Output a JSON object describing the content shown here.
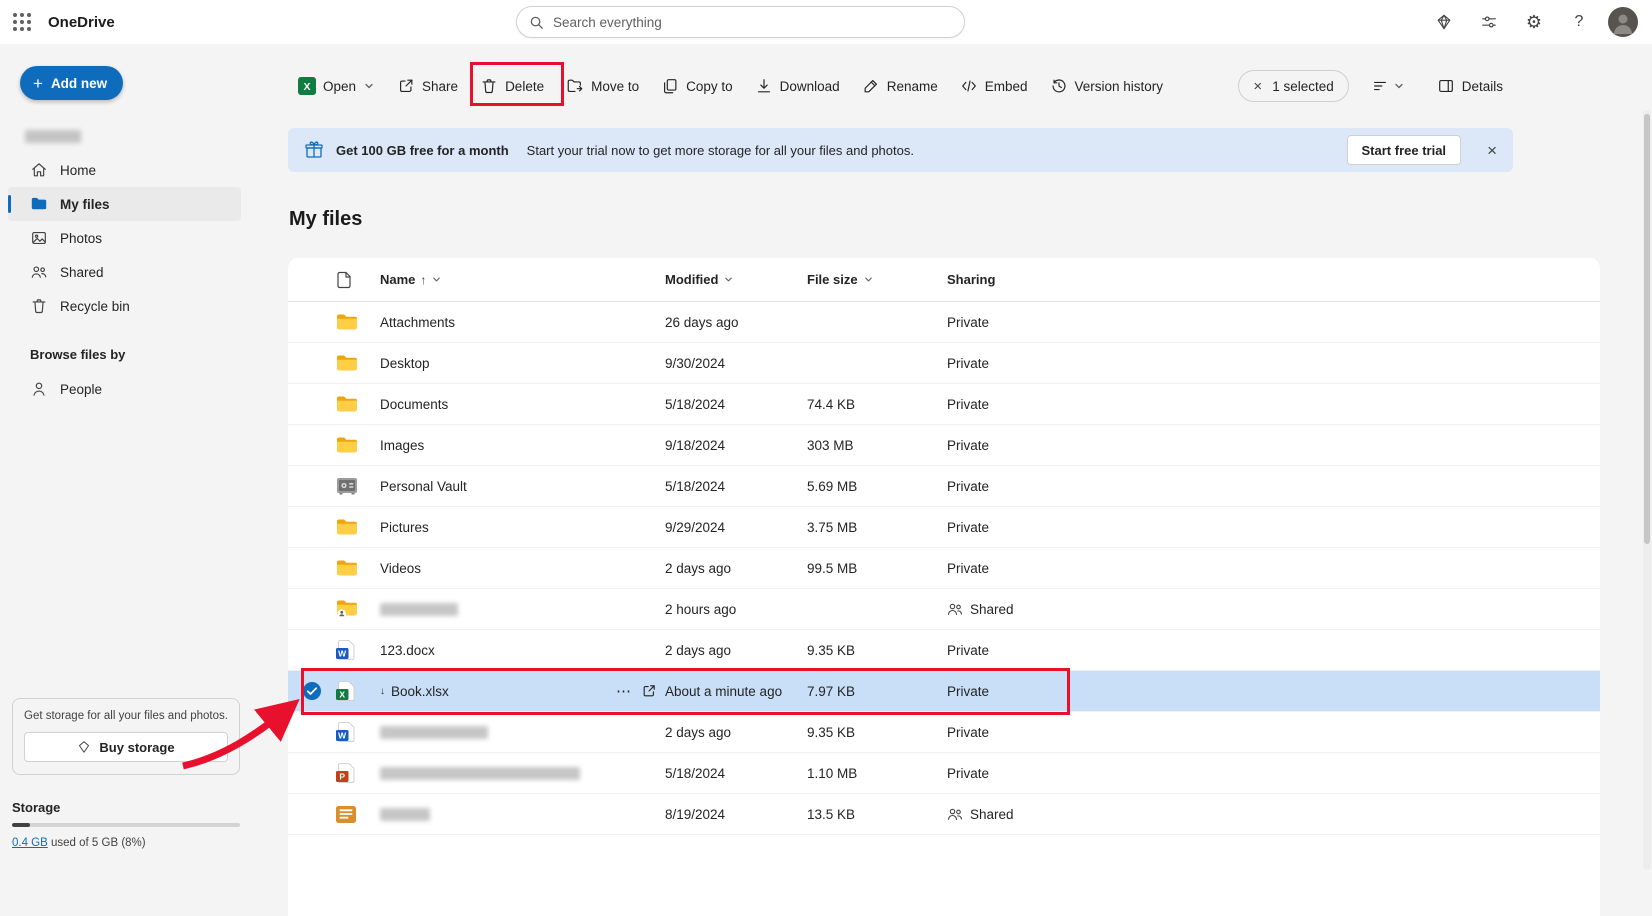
{
  "header": {
    "app_title": "OneDrive",
    "search_placeholder": "Search everything"
  },
  "toolbar": {
    "open": "Open",
    "share": "Share",
    "delete": "Delete",
    "move_to": "Move to",
    "copy_to": "Copy to",
    "download": "Download",
    "rename": "Rename",
    "embed": "Embed",
    "version_history": "Version history",
    "selected": "1 selected",
    "details": "Details"
  },
  "banner": {
    "title": "Get 100 GB free for a month",
    "subtitle": "Start your trial now to get more storage for all your files and photos.",
    "cta": "Start free trial"
  },
  "sidebar": {
    "add_new": "Add new",
    "items": [
      {
        "label": "Home"
      },
      {
        "label": "My files"
      },
      {
        "label": "Photos"
      },
      {
        "label": "Shared"
      },
      {
        "label": "Recycle bin"
      }
    ],
    "browse_heading": "Browse files by",
    "people": "People",
    "promo_text": "Get storage for all your files and photos.",
    "promo_cta": "Buy storage",
    "storage_heading": "Storage",
    "storage_used_link": "0.4 GB",
    "storage_usage_rest": " used of 5 GB (8%)",
    "storage_percent": 8
  },
  "main": {
    "heading": "My files",
    "columns": {
      "name": "Name",
      "modified": "Modified",
      "file_size": "File size",
      "sharing": "Sharing"
    },
    "rows": [
      {
        "type": "folder",
        "name": "Attachments",
        "modified": "26 days ago",
        "size": "",
        "sharing": "Private"
      },
      {
        "type": "folder",
        "name": "Desktop",
        "modified": "9/30/2024",
        "size": "",
        "sharing": "Private"
      },
      {
        "type": "folder",
        "name": "Documents",
        "modified": "5/18/2024",
        "size": "74.4 KB",
        "sharing": "Private"
      },
      {
        "type": "folder",
        "name": "Images",
        "modified": "9/18/2024",
        "size": "303 MB",
        "sharing": "Private"
      },
      {
        "type": "vault",
        "name": "Personal Vault",
        "modified": "5/18/2024",
        "size": "5.69 MB",
        "sharing": "Private"
      },
      {
        "type": "folder",
        "name": "Pictures",
        "modified": "9/29/2024",
        "size": "3.75 MB",
        "sharing": "Private"
      },
      {
        "type": "folder",
        "name": "Videos",
        "modified": "2 days ago",
        "size": "99.5 MB",
        "sharing": "Private"
      },
      {
        "type": "folder-shared",
        "name": "",
        "redacted": true,
        "redacted_width": 78,
        "modified": "2 hours ago",
        "size": "",
        "sharing": "Shared"
      },
      {
        "type": "word",
        "name": "123.docx",
        "modified": "2 days ago",
        "size": "9.35 KB",
        "sharing": "Private"
      },
      {
        "type": "excel",
        "name": "Book.xlsx",
        "modified": "About a minute ago",
        "size": "7.97 KB",
        "sharing": "Private",
        "selected": true
      },
      {
        "type": "word",
        "name": "",
        "redacted": true,
        "redacted_width": 108,
        "modified": "2 days ago",
        "size": "9.35 KB",
        "sharing": "Private"
      },
      {
        "type": "powerpoint",
        "name": "",
        "redacted": true,
        "redacted_width": 200,
        "modified": "5/18/2024",
        "size": "1.10 MB",
        "sharing": "Private"
      },
      {
        "type": "stripes",
        "name": "",
        "redacted": true,
        "redacted_width": 50,
        "modified": "8/19/2024",
        "size": "13.5 KB",
        "sharing": "Shared"
      }
    ]
  },
  "annotations": {
    "color": "#e8112d",
    "box_1_target": "delete-button",
    "box_2_target": "selected-row",
    "arrow_target": "selected-row"
  }
}
